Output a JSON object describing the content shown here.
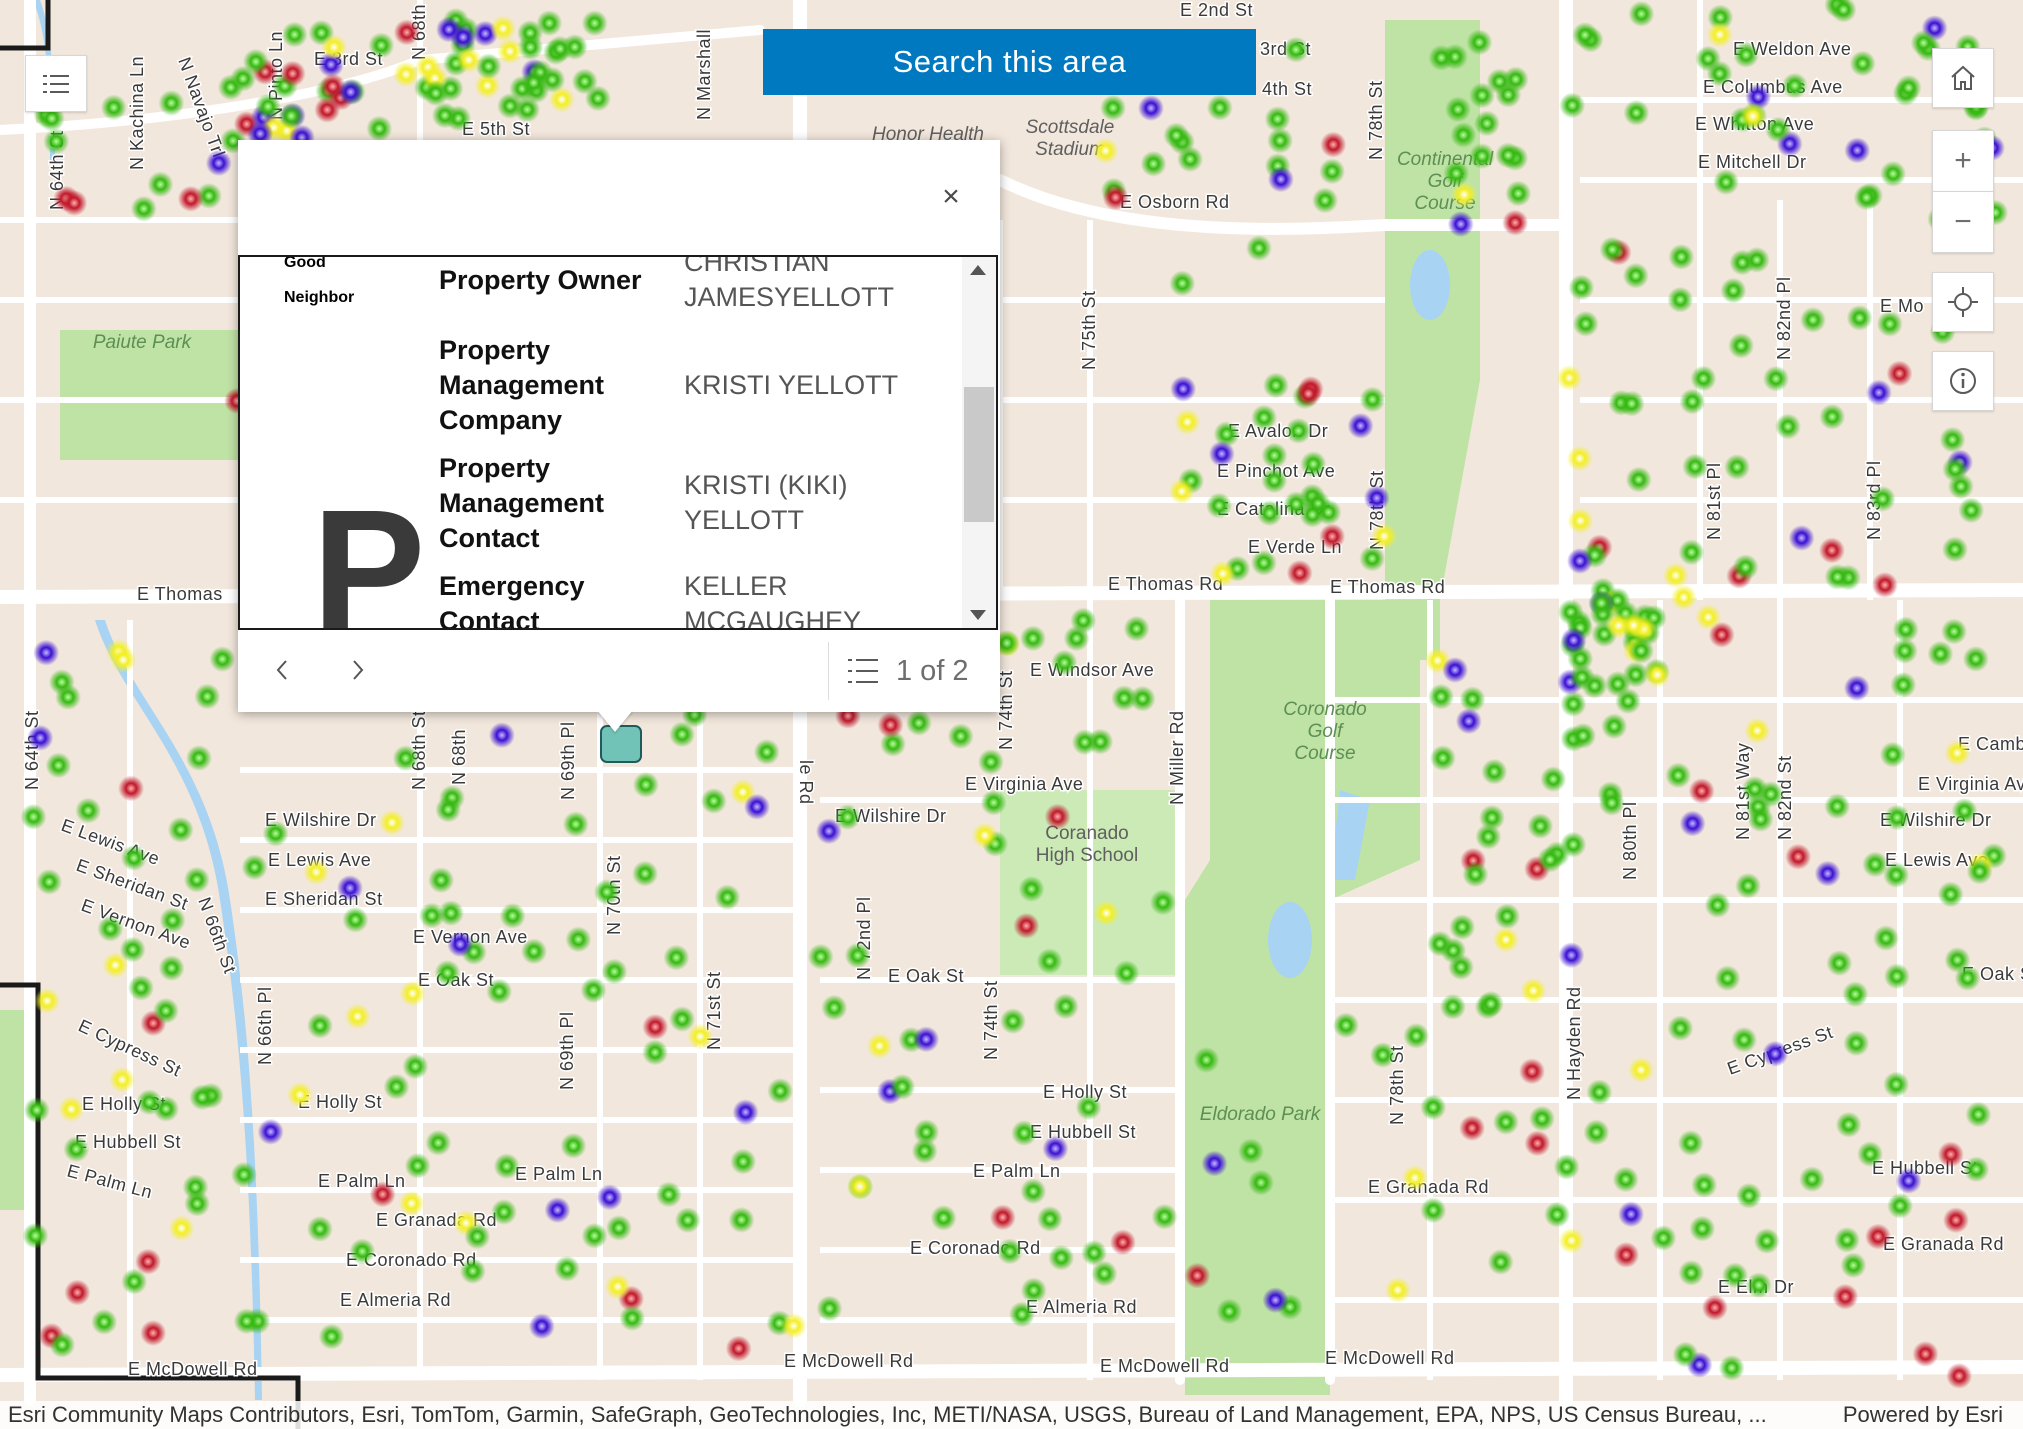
{
  "map": {
    "colors": {
      "land": "#f2e7dc",
      "road": "#ffffff",
      "park": "#bfe3a5",
      "water": "#a9d3f2",
      "dot_green": "#3cb81a",
      "dot_red": "#c21d2a",
      "dot_blue": "#3b0fd3",
      "dot_yellow": "#f4f12b"
    },
    "place_labels": [
      "Scottsdale\nStadium",
      "Honor Health",
      "Continental\nGolf\nCourse",
      "Paiute Park",
      "Coronado\nGolf\nCourse",
      "Coranado\nHigh School",
      "Eldorado Park"
    ],
    "street_labels": [
      "E 2nd St",
      "E 3rd St",
      "E 4th St",
      "E 5th St",
      "E Osborn Rd",
      "E Thomas Rd",
      "E McDowell Rd",
      "E Weldon Ave",
      "E Columbus Ave",
      "E Whitton Ave",
      "E Mitchell Dr",
      "E Avalon Dr",
      "E Pinchot Ave",
      "E Catalina Dr",
      "E Verde Ln",
      "E Windsor Ave",
      "E Virginia Ave",
      "E Wilshire Dr",
      "E Lewis Ave",
      "E Sheridan St",
      "E Vernon Ave",
      "E Oak St",
      "E Cypress St",
      "E Holly St",
      "E Hubbell St",
      "E Palm Ln",
      "E Granada Rd",
      "E Coronado Rd",
      "E Almeria Rd",
      "E Elm Dr",
      "E Camb",
      "E Mo",
      "N 64th St",
      "N 68th St",
      "N 69th Pl",
      "N 70th St",
      "N 71st St",
      "N 72nd Pl",
      "N 74th St",
      "N 75th St",
      "N 78th St",
      "N 80th Pl",
      "N 81st Pl",
      "N 82nd Pl",
      "N 83rd Pl",
      "N Hayden Rd",
      "N Miller Rd",
      "N Marshall",
      "N Pinto Ln",
      "N Navajo Trl",
      "N Kachina Ln",
      "N 66th Pl",
      "N 66th St"
    ]
  },
  "controls": {
    "search_area": "Search this area",
    "menu_icon": "list-icon",
    "home_icon": "home-icon",
    "zoom_in": "+",
    "zoom_out": "−",
    "locate_icon": "locate-icon",
    "info_icon": "info-icon"
  },
  "popup": {
    "close_label": "×",
    "good_neighbor": "Good\nNeighbor",
    "logo_letter": "P",
    "fields": [
      {
        "label": "Property Owner",
        "value": "CHRISTIAN\nJAMESYELLOTT"
      },
      {
        "label": "Property\nManagement\nCompany",
        "value": "KRISTI YELLOTT"
      },
      {
        "label": "Property\nManagement\nContact",
        "value": "KRISTI (KIKI)\nYELLOTT"
      },
      {
        "label": "Emergency\nContact",
        "value": "KELLER\nMCGAUGHEY"
      }
    ],
    "prev_icon": "chevron-left-icon",
    "next_icon": "chevron-right-icon",
    "list_icon": "feature-list-icon",
    "page_text": "1 of 2"
  },
  "attribution": {
    "left": "Esri Community Maps Contributors, Esri, TomTom, Garmin, SafeGraph, GeoTechnologies, Inc, METI/NASA, USGS, Bureau of Land Management, EPA, NPS, US Census Bureau, ...",
    "right": "Powered by Esri"
  }
}
